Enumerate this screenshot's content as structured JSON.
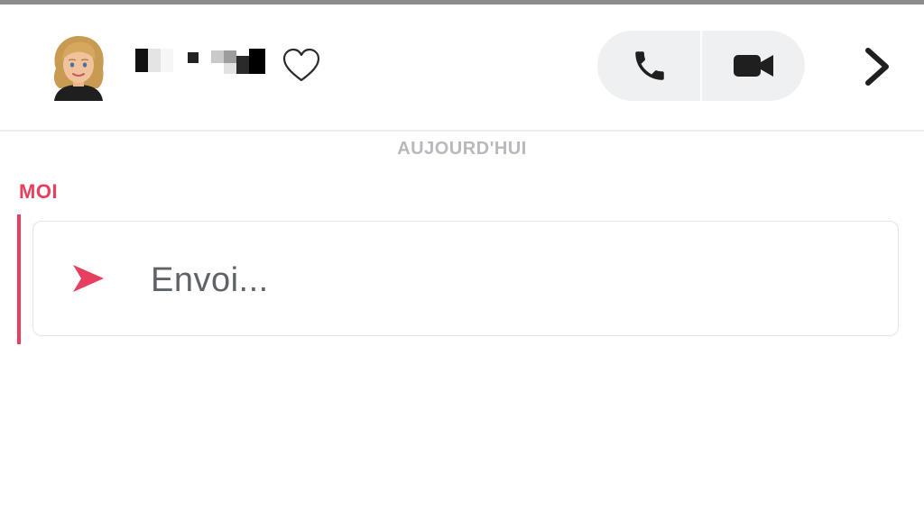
{
  "header": {
    "contact_name_hidden": true,
    "voice_call_icon": "phone-icon",
    "video_call_icon": "video-camera-icon",
    "favorite_icon": "heart-outline-icon",
    "next_icon": "chevron-right-icon"
  },
  "chat": {
    "day_label": "AUJOURD'HUI",
    "sender_label": "MOI",
    "message": {
      "status_text": "Envoi...",
      "icon": "send-arrow-icon"
    }
  },
  "colors": {
    "accent": "#e83f5e",
    "muted_text": "#b7b9bd",
    "message_text": "#5f6368",
    "pill_background": "#eef0f2"
  }
}
